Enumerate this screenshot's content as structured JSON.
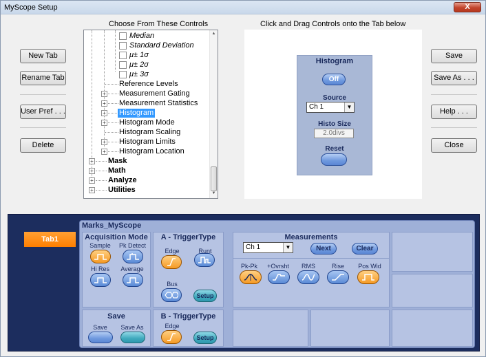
{
  "window": {
    "title": "MyScope Setup",
    "close_label": "X"
  },
  "left_buttons": {
    "new_tab": "New Tab",
    "rename_tab": "Rename Tab",
    "user_pref": "User Pref . . .",
    "delete": "Delete"
  },
  "right_buttons": {
    "save": "Save",
    "save_as": "Save As . . .",
    "help": "Help . . .",
    "close": "Close"
  },
  "headers": {
    "choose": "Choose From These Controls",
    "drag": "Click and Drag Controls onto the Tab below"
  },
  "tree": {
    "items": [
      {
        "label": "Median",
        "italic": true
      },
      {
        "label": "Standard Deviation",
        "italic": true
      },
      {
        "label": "μ± 1σ",
        "italic": true
      },
      {
        "label": "μ± 2σ",
        "italic": true
      },
      {
        "label": "μ± 3σ",
        "italic": true
      },
      {
        "label": "Reference Levels"
      },
      {
        "label": "Measurement Gating"
      },
      {
        "label": "Measurement Statistics"
      },
      {
        "label": "Histogram",
        "selected": true
      },
      {
        "label": "Histogram Mode"
      },
      {
        "label": "Histogram Scaling"
      },
      {
        "label": "Histogram Limits"
      },
      {
        "label": "Histogram Location"
      },
      {
        "label": "Mask",
        "bold": true
      },
      {
        "label": "Math",
        "bold": true
      },
      {
        "label": "Analyze",
        "bold": true
      },
      {
        "label": "Utilities",
        "bold": true
      }
    ],
    "scroll_up": "▲",
    "scroll_down": "▼"
  },
  "histogram_panel": {
    "title": "Histogram",
    "toggle": "Off",
    "source_label": "Source",
    "source_value": "Ch 1",
    "histo_size_label": "Histo Size",
    "histo_size_value": "2.0divs",
    "reset_label": "Reset"
  },
  "bottom": {
    "tab_label": "Tab1",
    "panel_title": "Marks_MyScope",
    "acquisition": {
      "title": "Acquisition Mode",
      "sample": "Sample",
      "pk_detect": "Pk Detect",
      "hi_res": "Hi Res",
      "average": "Average"
    },
    "save": {
      "title": "Save",
      "save": "Save",
      "save_as": "Save As"
    },
    "trigger_a": {
      "title": "A - TriggerType",
      "edge": "Edge",
      "runt": "Runt",
      "bus": "Bus",
      "setup": "Setup"
    },
    "trigger_b": {
      "title": "B - TriggerType",
      "edge": "Edge",
      "setup": "Setup"
    },
    "measurements": {
      "title": "Measurements",
      "source": "Ch 1",
      "next": "Next",
      "clear": "Clear",
      "items": [
        "Pk-Pk",
        "+Ovrsht",
        "RMS",
        "Rise",
        "Pos Wid"
      ]
    }
  },
  "colors": {
    "accent_orange": "#ff8c1a",
    "panel_blue": "#9fb0d8",
    "dark_navy": "#1c2d5e",
    "selection": "#3399ff"
  }
}
